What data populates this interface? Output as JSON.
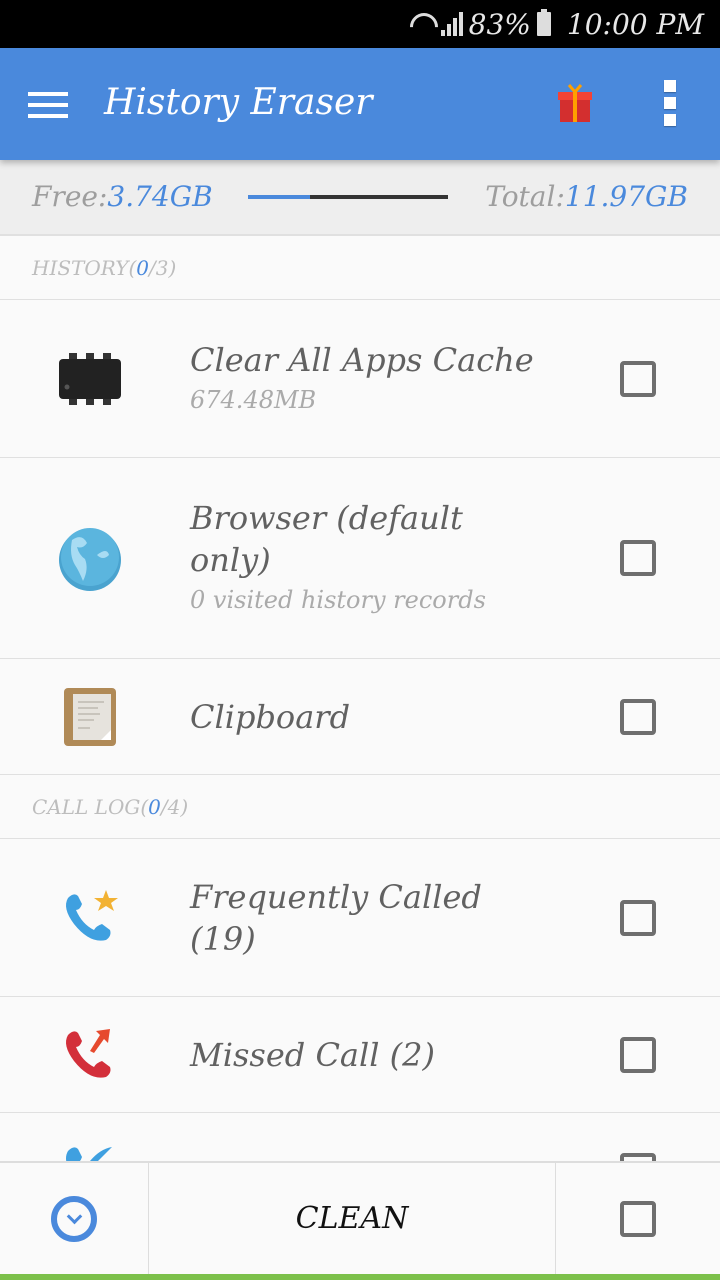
{
  "status_bar": {
    "battery_percent": "83%",
    "time": "10:00 PM",
    "icons": [
      "wifi-icon",
      "signal-icon",
      "battery-icon"
    ]
  },
  "app_bar": {
    "title": "History Eraser",
    "color": "#4a89dc",
    "icons": [
      "menu-icon",
      "gift-icon",
      "more-vert-icon"
    ]
  },
  "storage": {
    "free_label": "Free:",
    "free_value": "3.74GB",
    "total_label": "Total:",
    "total_value": "11.97GB",
    "used_fraction": 0.31
  },
  "sections": [
    {
      "label": "HISTORY",
      "selected": "0",
      "total": "3",
      "items": [
        {
          "icon": "chip-icon",
          "title": "Clear All Apps Cache",
          "subtitle": "674.48MB",
          "checked": false
        },
        {
          "icon": "globe-icon",
          "title": "Browser (default only)",
          "subtitle": "0 visited history records",
          "checked": false
        },
        {
          "icon": "clipboard-icon",
          "title": "Clipboard",
          "subtitle": "",
          "checked": false
        }
      ]
    },
    {
      "label": "CALL LOG",
      "selected": "0",
      "total": "4",
      "items": [
        {
          "icon": "phone-star-icon",
          "title": "Frequently Called (19)",
          "subtitle": "",
          "checked": false
        },
        {
          "icon": "missed-call-icon",
          "title": "Missed Call (2)",
          "subtitle": "",
          "checked": false
        },
        {
          "icon": "outgoing-call-icon",
          "title": "",
          "subtitle": "",
          "checked": false
        }
      ]
    }
  ],
  "bottom_bar": {
    "clean_label": "CLEAN",
    "select_all_checked": false
  }
}
